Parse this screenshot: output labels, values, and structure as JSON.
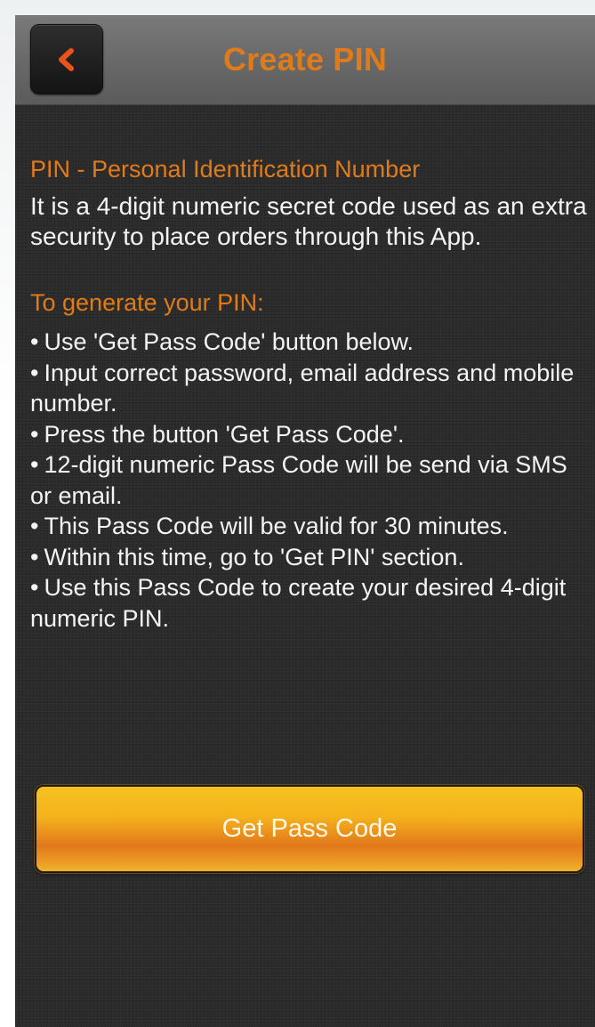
{
  "header": {
    "title": "Create PIN",
    "back_icon": "chevron-left-icon"
  },
  "content": {
    "heading1": "PIN - Personal Identification Number",
    "description": "It is a 4-digit numeric secret code used as an extra security to place orders through this App.",
    "heading2": "To generate your PIN:",
    "bullet_glyph": "•",
    "steps": [
      "Use 'Get Pass Code' button below.",
      "Input correct password, email address and mobile number.",
      "Press the button 'Get Pass Code'.",
      "12-digit numeric Pass Code will be send via SMS or email.",
      "This Pass Code will be valid for 30 minutes.",
      "Within this time, go to 'Get PIN' section.",
      "Use this Pass Code to create your desired 4-digit numeric PIN."
    ]
  },
  "actions": {
    "get_pass_code_label": "Get Pass Code"
  },
  "colors": {
    "accent": "#e07b1a",
    "background": "#2d2d2d",
    "topbar": "#6b6b6b",
    "button_gold": "#f4b31c"
  }
}
